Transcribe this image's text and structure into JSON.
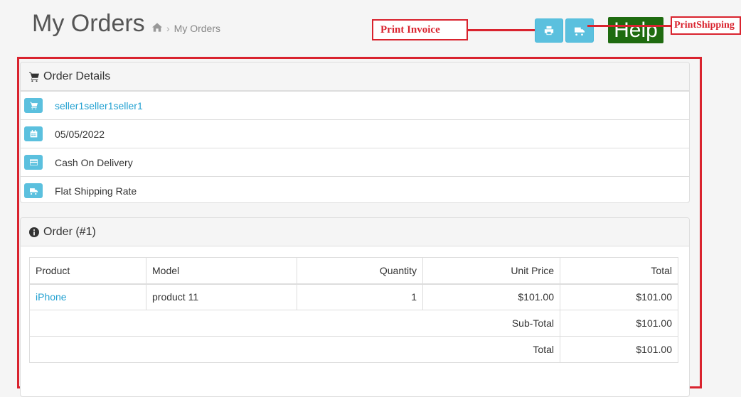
{
  "header": {
    "title": "My Orders",
    "breadcrumb": {
      "separator": "›",
      "current": "My Orders"
    }
  },
  "toolbar": {
    "print_invoice_icon": "print-icon",
    "print_shipping_icon": "truck-icon",
    "help_label": "Help"
  },
  "annotations": {
    "print_invoice": "Print Invoice",
    "print_shipping": "PrintShipping"
  },
  "order_details": {
    "heading": "Order Details",
    "rows": [
      {
        "icon": "cart-icon",
        "text": "seller1seller1seller1"
      },
      {
        "icon": "calendar-icon",
        "text": "05/05/2022"
      },
      {
        "icon": "credit-card-icon",
        "text": "Cash On Delivery"
      },
      {
        "icon": "truck-icon",
        "text": "Flat Shipping Rate"
      }
    ]
  },
  "order": {
    "heading": "Order (#1)",
    "columns": [
      "Product",
      "Model",
      "Quantity",
      "Unit Price",
      "Total"
    ],
    "items": [
      {
        "product": "iPhone",
        "model": "product 11",
        "quantity": "1",
        "unit_price": "$101.00",
        "total": "$101.00"
      }
    ],
    "totals": [
      {
        "label": "Sub-Total",
        "value": "$101.00"
      },
      {
        "label": "Total",
        "value": "$101.00"
      }
    ]
  },
  "colors": {
    "info": "#5bc0de",
    "help": "#1f6b10",
    "annotation": "#d9232e",
    "link": "#23a1d1"
  }
}
